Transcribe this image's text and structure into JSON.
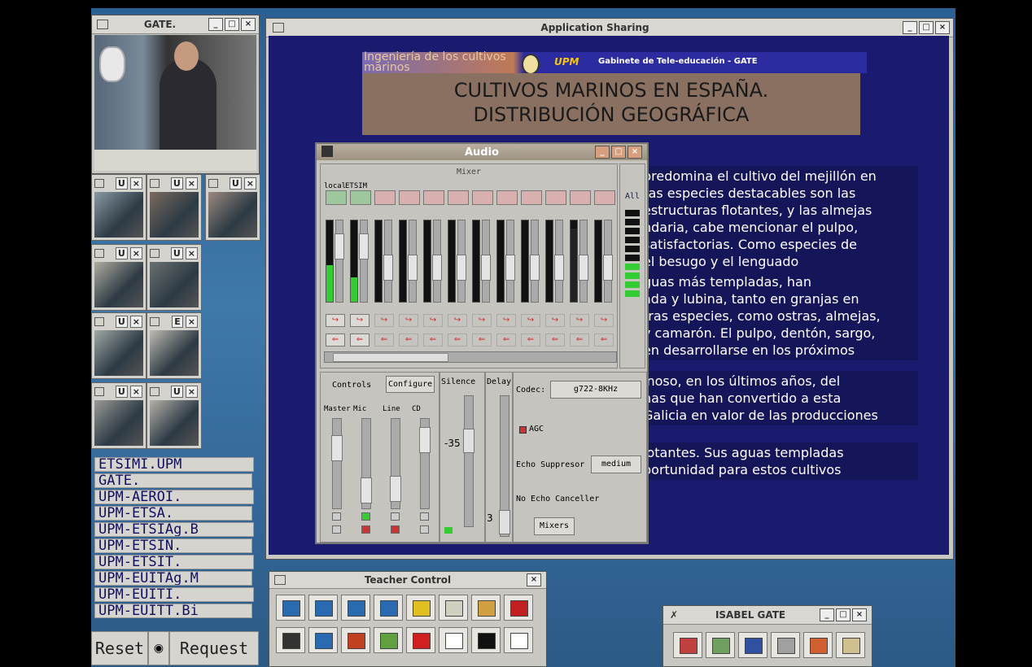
{
  "gate_window": {
    "title": "GATE."
  },
  "video_thumbs": [
    {
      "btns": [
        "U",
        "×"
      ]
    },
    {
      "btns": [
        "U",
        "×"
      ]
    },
    {
      "btns": [
        "U",
        "×"
      ]
    },
    {
      "btns": [
        "U",
        "×"
      ]
    },
    {
      "btns": [
        "U",
        "×"
      ]
    },
    {
      "btns": [
        "U",
        "×"
      ]
    },
    {
      "btns": [
        "E",
        "×"
      ]
    },
    {
      "btns": [
        "U",
        "×"
      ]
    },
    {
      "btns": [
        "U",
        "×"
      ]
    }
  ],
  "site_list": [
    "ETSIMI.UPM",
    "GATE.",
    "UPM-AEROI.",
    "UPM-ETSA.",
    "UPM-ETSIAg.B",
    "UPM-ETSIN.",
    "UPM-ETSIT.",
    "UPM-EUITAg.M",
    "UPM-EUITI.",
    "UPM-EUITT.Bi"
  ],
  "bottom_buttons": {
    "reset": "Reset",
    "request": "Request"
  },
  "app_sharing": {
    "title": "Application Sharing",
    "banner_left": "Ingeniería de los cultivos marinos",
    "banner_brand": "UPM",
    "banner_right": "Gabinete de Tele-educación - GATE",
    "slide_title_1": "CULTIVOS MARINOS EN ESPAÑA.",
    "slide_title_2": "DISTRIBUCIÓN GEOGRÁFICA",
    "para1": [
      " predomina el cultivo del mejillón en",
      "ras especies destacables son las",
      "estructuras flotantes, y las almejas",
      "ndaria, cabe mencionar el pulpo,",
      " satisfactorias. Como especies de",
      "el besugo y el lenguado"
    ],
    "para2": [
      "guas más templadas, han",
      "ada y lubina, tanto en granjas en",
      "tras especies, como ostras, almejas,",
      "y camarón. El pulpo, dentón, sargo,",
      "en desarrollarse en los próximos"
    ],
    "para3": [
      "inoso, en los últimos años, del",
      "nas que han convertido a esta",
      "Galicia en valor de las producciones"
    ],
    "para4": [
      "lotantes. Sus aguas templadas",
      "portunidad para estos cultivos"
    ]
  },
  "audio": {
    "title": "Audio",
    "mixer_label": "Mixer",
    "ch_local": "local",
    "ch_etsim": "ETSIM",
    "all_label": "All",
    "tab_controls": "Controls",
    "tab_configure": "Configure",
    "silence_label": "Silence",
    "delay_label": "Delay",
    "silence_value": "-35",
    "delay_value": "3",
    "slider_labels": [
      "Master",
      "Mic",
      "Line",
      "CD"
    ],
    "codec_label": "Codec:",
    "codec_value": "g722-8KHz",
    "agc_label": "AGC",
    "echo_suppressor_label": "Echo Suppresor",
    "echo_suppressor_value": "medium",
    "echo_canceller_label": "No Echo Canceller",
    "mixers_button": "Mixers"
  },
  "teacher_control": {
    "title": "Teacher Control"
  },
  "isabel_gate": {
    "title": "ISABEL GATE"
  }
}
